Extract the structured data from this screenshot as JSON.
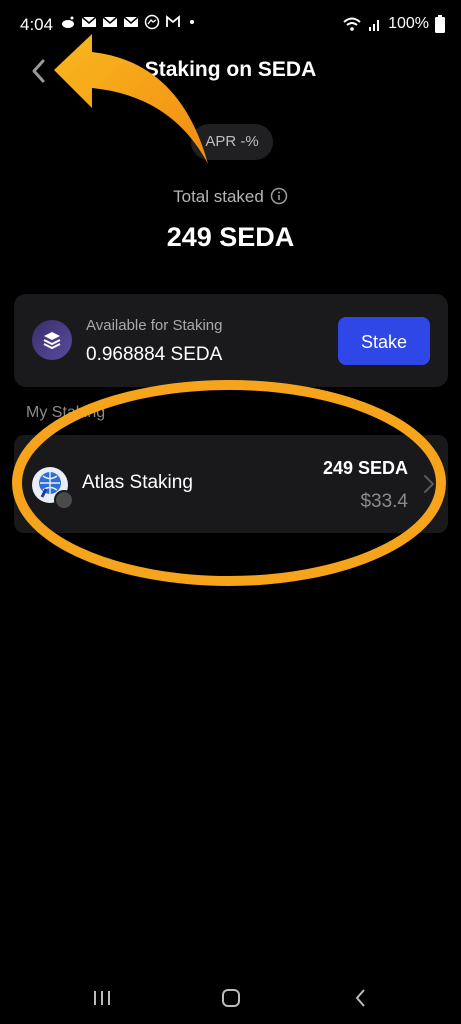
{
  "status_bar": {
    "time": "4:04",
    "battery": "100%",
    "notification_icons": [
      "reddit-icon",
      "mail-icon",
      "mail-icon",
      "mail-icon",
      "messenger-icon",
      "gmail-icon",
      "dot-icon"
    ]
  },
  "header": {
    "title": "Staking on SEDA"
  },
  "apr": {
    "label": "APR -%"
  },
  "total_staked": {
    "label": "Total staked",
    "value": "249 SEDA"
  },
  "available": {
    "label": "Available for Staking",
    "value": "0.968884 SEDA",
    "button_label": "Stake"
  },
  "my_staking": {
    "section_label": "My Staking",
    "items": [
      {
        "name": "Atlas Staking",
        "amount": "249 SEDA",
        "usd": "$33.4"
      }
    ]
  },
  "colors": {
    "background": "#000000",
    "card": "#1a1a1c",
    "stake_button": "#2f47e6",
    "annotation_orange": "#f6a41c"
  }
}
